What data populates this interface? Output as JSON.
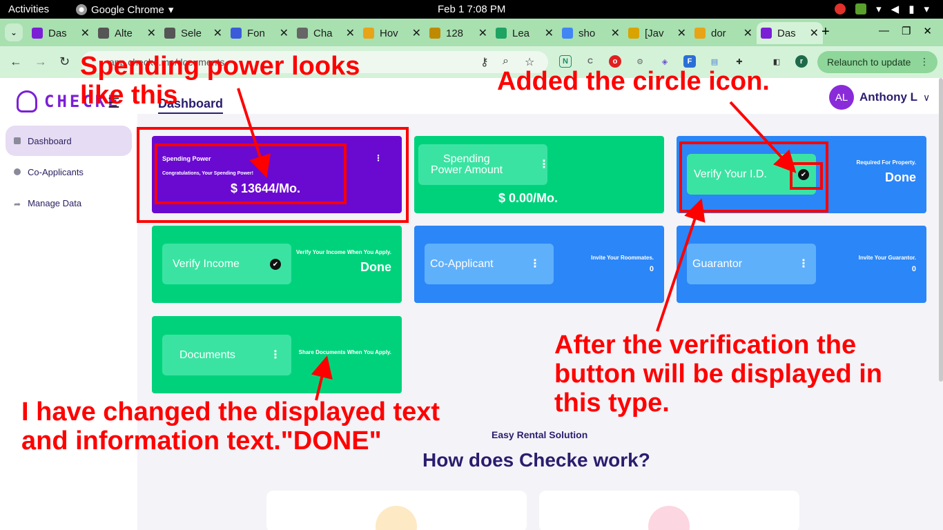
{
  "os_bar": {
    "activities": "Activities",
    "app_name": "Google Chrome",
    "clock": "Feb 1   7:08 PM"
  },
  "tabs": [
    {
      "title": "Das",
      "favicon_color": "#7b1fd6",
      "active": false
    },
    {
      "title": "Alte",
      "favicon_color": "#555555",
      "active": false
    },
    {
      "title": "Sele",
      "favicon_color": "#555555",
      "active": false
    },
    {
      "title": "Fon",
      "favicon_color": "#3b5bdb",
      "active": false
    },
    {
      "title": "Cha",
      "favicon_color": "#666666",
      "active": false
    },
    {
      "title": "Hov",
      "favicon_color": "#e8a317",
      "active": false
    },
    {
      "title": "128",
      "favicon_color": "#c08a00",
      "active": false
    },
    {
      "title": "Lea",
      "favicon_color": "#1ea362",
      "active": false
    },
    {
      "title": "sho",
      "favicon_color": "#4285f4",
      "active": false
    },
    {
      "title": "[Jav",
      "favicon_color": "#d9a400",
      "active": false
    },
    {
      "title": "dor",
      "favicon_color": "#e8a317",
      "active": false
    },
    {
      "title": "Das",
      "favicon_color": "#7b1fd6",
      "active": true
    }
  ],
  "toolbar": {
    "url": "app.checke.me/documents",
    "relaunch_label": "Relaunch to update",
    "profile_initial": "r"
  },
  "sidebar": {
    "brand": "CHECKE",
    "items": [
      {
        "label": "Dashboard",
        "active": true
      },
      {
        "label": "Co-Applicants",
        "active": false
      },
      {
        "label": "Manage Data",
        "active": false
      }
    ]
  },
  "header": {
    "breadcrumb": "Dashboard",
    "avatar_initials": "AL",
    "user_name": "Anthony L"
  },
  "cards": {
    "spending_power": {
      "title": "Spending Power",
      "subtitle": "Congratulations, Your Spending Power!",
      "amount": "$ 13644/Mo."
    },
    "spending_amount": {
      "title_line1": "Spending",
      "title_line2": "Power Amount",
      "amount": "$ 0.00/Mo."
    },
    "verify_id": {
      "title": "Verify Your I.D.",
      "note": "Required For Property.",
      "status": "Done"
    },
    "verify_income": {
      "title": "Verify Income",
      "note": "Verify Your Income When You Apply.",
      "status": "Done"
    },
    "co_applicant": {
      "title": "Co-Applicant",
      "note": "Invite Your Roommates.",
      "count": "0"
    },
    "guarantor": {
      "title": "Guarantor",
      "note": "Invite Your Guarantor.",
      "count": "0"
    },
    "documents": {
      "title": "Documents",
      "note": "Share Documents When You Apply."
    }
  },
  "section": {
    "eyebrow": "Easy Rental Solution",
    "heading": "How does Checke work?"
  },
  "annotations": {
    "spending_note": "Spending power looks like this",
    "circle_note": "Added the circle icon.",
    "verification_note": "After the verification the button will be displayed in this type.",
    "done_note": "I have changed the displayed text and information text.\"DONE\""
  },
  "colors": {
    "green": "#00d27c",
    "blue": "#2b86f7",
    "purple": "#6a0ad1",
    "annotation_red": "#ff0000",
    "brand": "#7b1fd6"
  }
}
